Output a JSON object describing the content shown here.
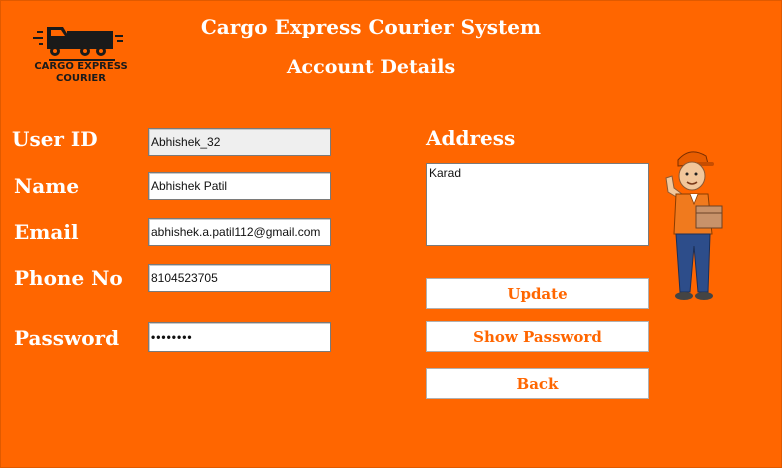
{
  "header": {
    "app_title": "Cargo Express Courier System",
    "page_title": "Account Details",
    "logo_text_line1": "CARGO EXPRESS",
    "logo_text_line2": "COURIER"
  },
  "form": {
    "user_id": {
      "label": "User ID",
      "value": "Abhishek_32"
    },
    "name": {
      "label": "Name",
      "value": "Abhishek Patil"
    },
    "email": {
      "label": "Email",
      "value": "abhishek.a.patil112@gmail.com"
    },
    "phone": {
      "label": "Phone No",
      "value": "8104523705"
    },
    "password": {
      "label": "Password",
      "value": "••••••••"
    },
    "address": {
      "label": "Address",
      "value": "Karad"
    }
  },
  "buttons": {
    "update": "Update",
    "show_password": "Show Password",
    "back": "Back"
  },
  "colors": {
    "background": "#ff6600",
    "button_text": "#ff6600",
    "text": "#ffffff"
  },
  "icons": {
    "logo": "truck-icon",
    "mascot": "courier-person-icon"
  }
}
